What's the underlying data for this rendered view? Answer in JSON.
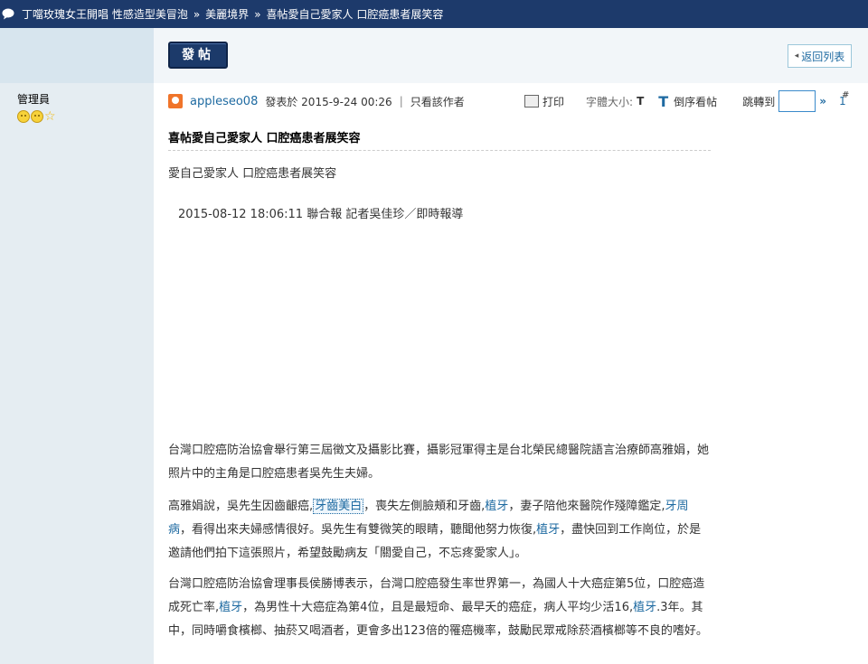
{
  "topbar": {
    "crumb1": "丁噹玫瑰女王開唱 性感造型美冒泡",
    "crumb2": "美麗境界",
    "crumb3": "喜帖愛自己愛家人 口腔癌患者展笑容",
    "sep": "»"
  },
  "sidebar": {
    "role": "管理員"
  },
  "toolbar": {
    "post_label": "發帖",
    "back_label": "返回列表"
  },
  "post": {
    "author": "appleseo08",
    "posted_at": "發表於 2015-9-24 00:26",
    "only_author": "只看該作者",
    "print": "打印",
    "fontsize_label": "字體大小:",
    "fontsize_t": "T",
    "reverse_t": "T",
    "reverse": "倒序看帖",
    "jump": "跳轉到",
    "jump_go": "»",
    "floor": "1",
    "floor_hash": "#",
    "title": "喜帖愛自己愛家人 口腔癌患者展笑容",
    "subtitle": "愛自己愛家人 口腔癌患者展笑容",
    "dateline": "2015-08-12 18:06:11 聯合報 記者吳佳珍／即時報導",
    "p1": "台灣口腔癌防治協會舉行第三屆徵文及攝影比賽，攝影冠軍得主是台北榮民總醫院語言治療師高雅娟，她照片中的主角是口腔癌患者吳先生夫婦。",
    "p2a": "高雅娟說，吳先生因齒齦癌,",
    "p2_kw1": "牙齒美白",
    "p2b": "，喪失左側臉頰和牙齒,",
    "p2_kw2": "植牙",
    "p2c": "，妻子陪他來醫院作殘障鑑定,",
    "p2_kw3": "牙周病",
    "p2d": "，看得出來夫婦感情很好。吳先生有雙微笑的眼睛，聽聞他努力恢復,",
    "p2_kw4": "植牙",
    "p2e": "，盡快回到工作崗位，於是邀請他們拍下這張照片，希望鼓勵病友「關愛自己，不忘疼愛家人」。",
    "p3a": "台灣口腔癌防治協會理事長侯勝博表示，台灣口腔癌發生率世界第一，為國人十大癌症第5位，口腔癌造成死亡率,",
    "p3_kw1": "植牙",
    "p3b": "，為男性十大癌症為第4位，且是最短命、最早夭的癌症，病人平均少活16,",
    "p3_kw2": "植牙",
    "p3c": ".3年。其中，同時嚼食檳榔、抽菸又喝酒者，更會多出123倍的罹癌機率，鼓勵民眾戒除菸酒檳榔等不良的嗜好。"
  }
}
